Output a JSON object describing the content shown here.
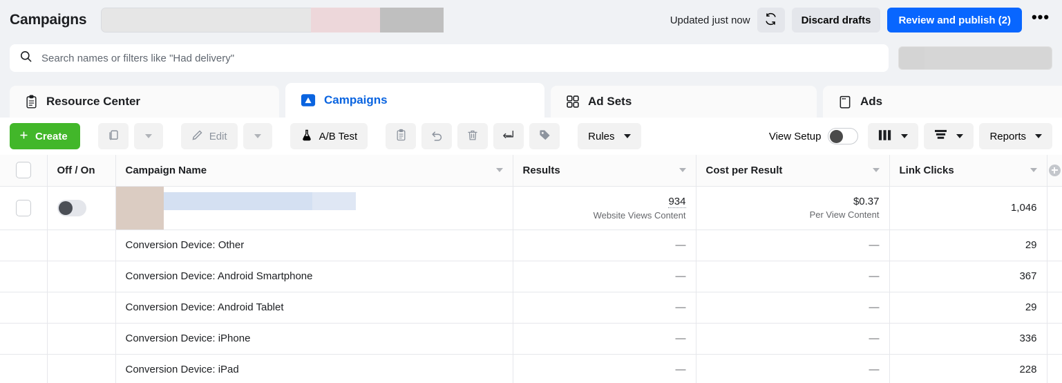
{
  "header": {
    "title": "Campaigns",
    "updated_text": "Updated just now",
    "refresh_icon": "refresh-icon",
    "discard_label": "Discard drafts",
    "publish_label": "Review and publish (2)",
    "more_label": "•••",
    "accent_blue": "#0866ff"
  },
  "search": {
    "icon": "search-icon",
    "value": "",
    "placeholder": "Search names or filters like \"Had delivery\""
  },
  "tabs": [
    {
      "label": "Resource Center",
      "icon": "clipboard-icon",
      "active": false
    },
    {
      "label": "Campaigns",
      "icon": "campaign-flag-icon",
      "active": true
    },
    {
      "label": "Ad Sets",
      "icon": "grid-squares-icon",
      "active": false
    },
    {
      "label": "Ads",
      "icon": "ad-window-icon",
      "active": false
    }
  ],
  "toolbar": {
    "create_label": "Create",
    "create_icon": "plus-icon",
    "create_color": "#42b72a",
    "duplicate_icon": "duplicate-icon",
    "duplicate_caret_icon": "chevron-down-icon",
    "edit_label": "Edit",
    "edit_icon": "pencil-icon",
    "edit_caret_icon": "chevron-down-icon",
    "abtest_label": "A/B Test",
    "abtest_icon": "flask-icon",
    "paste_icon": "clipboard-paste-icon",
    "undo_icon": "undo-arrow-icon",
    "delete_icon": "trash-icon",
    "export_icon": "export-arrows-icon",
    "tag_icon": "tag-icon",
    "rules_label": "Rules",
    "rules_caret_icon": "chevron-down-icon",
    "view_setup_label": "View Setup",
    "view_setup_toggle": "toggle-switch",
    "columns_icon": "columns-icon",
    "columns_caret_icon": "chevron-down-icon",
    "breakdown_icon": "breakdown-bars-icon",
    "breakdown_caret_icon": "chevron-down-icon",
    "reports_label": "Reports",
    "reports_caret_icon": "chevron-down-icon"
  },
  "table": {
    "columns": [
      {
        "key": "check",
        "label": "",
        "sortable": false
      },
      {
        "key": "onoff",
        "label": "Off / On",
        "sortable": false
      },
      {
        "key": "name",
        "label": "Campaign Name",
        "sortable": true
      },
      {
        "key": "results",
        "label": "Results",
        "sortable": true
      },
      {
        "key": "cost",
        "label": "Cost per Result",
        "sortable": true
      },
      {
        "key": "links",
        "label": "Link Clicks",
        "sortable": true
      }
    ],
    "add_column_icon": "plus-circle-icon",
    "dash": "—",
    "rows": [
      {
        "type": "campaign",
        "name": "",
        "name_redacted": true,
        "toggle_state": "off",
        "results_value": "934",
        "results_sub": "Website Views Content",
        "cost_value": "$0.37",
        "cost_sub": "Per View Content",
        "link_clicks": "1,046"
      },
      {
        "type": "breakdown",
        "name": "Conversion Device: Other",
        "results_value": "—",
        "cost_value": "—",
        "link_clicks": "29"
      },
      {
        "type": "breakdown",
        "name": "Conversion Device: Android Smartphone",
        "results_value": "—",
        "cost_value": "—",
        "link_clicks": "367"
      },
      {
        "type": "breakdown",
        "name": "Conversion Device: Android Tablet",
        "results_value": "—",
        "cost_value": "—",
        "link_clicks": "29"
      },
      {
        "type": "breakdown",
        "name": "Conversion Device: iPhone",
        "results_value": "—",
        "cost_value": "—",
        "link_clicks": "336"
      },
      {
        "type": "breakdown",
        "name": "Conversion Device: iPad",
        "results_value": "—",
        "cost_value": "—",
        "link_clicks": "228"
      }
    ]
  }
}
